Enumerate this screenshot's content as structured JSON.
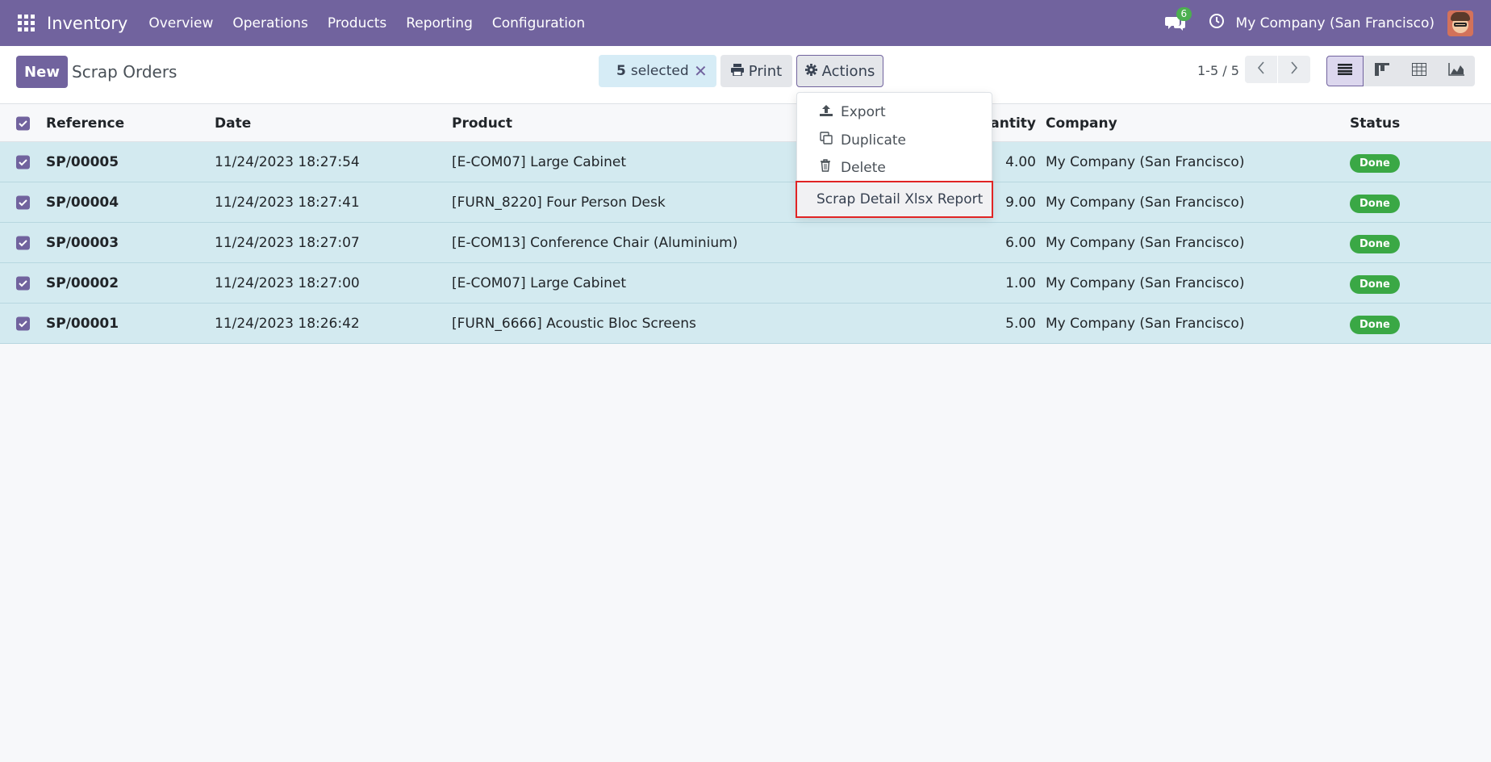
{
  "navbar": {
    "app_title": "Inventory",
    "menu": [
      "Overview",
      "Operations",
      "Products",
      "Reporting",
      "Configuration"
    ],
    "chat_count": "6",
    "company": "My Company (San Francisco)",
    "icons": [
      "apps-grid-icon",
      "chat-icon",
      "clock-icon",
      "avatar"
    ]
  },
  "control_panel": {
    "new_label": "New",
    "title": "Scrap Orders",
    "selected_count": "5",
    "selected_label": "selected",
    "print_label": "Print",
    "actions_label": "Actions",
    "pager": "1-5 / 5"
  },
  "dropdown": {
    "items": [
      "Export",
      "Duplicate",
      "Delete"
    ],
    "highlighted": "Scrap Detail Xlsx Report"
  },
  "table": {
    "headers": [
      "Reference",
      "Date",
      "Product",
      "Quantity",
      "Company",
      "Status"
    ],
    "visible_qty_header": "uantity",
    "rows": [
      {
        "ref": "SP/00005",
        "date": "11/24/2023 18:27:54",
        "product": "[E-COM07] Large Cabinet",
        "qty": "4.00",
        "company": "My Company (San Francisco)",
        "status": "Done"
      },
      {
        "ref": "SP/00004",
        "date": "11/24/2023 18:27:41",
        "product": "[FURN_8220] Four Person Desk",
        "qty": "9.00",
        "company": "My Company (San Francisco)",
        "status": "Done"
      },
      {
        "ref": "SP/00003",
        "date": "11/24/2023 18:27:07",
        "product": "[E-COM13] Conference Chair (Aluminium)",
        "qty": "6.00",
        "company": "My Company (San Francisco)",
        "status": "Done"
      },
      {
        "ref": "SP/00002",
        "date": "11/24/2023 18:27:00",
        "product": "[E-COM07] Large Cabinet",
        "qty": "1.00",
        "company": "My Company (San Francisco)",
        "status": "Done"
      },
      {
        "ref": "SP/00001",
        "date": "11/24/2023 18:26:42",
        "product": "[FURN_6666] Acoustic Bloc Screens",
        "qty": "5.00",
        "company": "My Company (San Francisco)",
        "status": "Done"
      }
    ]
  },
  "colors": {
    "primary": "#71639e",
    "selected_row": "#d3eaf0",
    "done_badge": "#3aa845",
    "highlight_border": "#e02424"
  }
}
